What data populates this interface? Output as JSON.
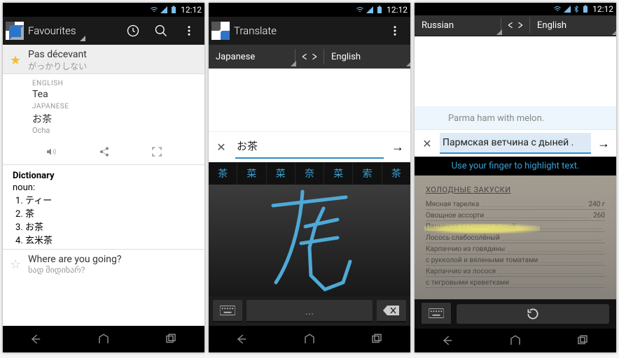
{
  "status": {
    "time": "12:12",
    "bt": true
  },
  "screen1": {
    "title": "Favourites",
    "rows": [
      {
        "main": "Pas décevant",
        "sub": "がっかりしない"
      }
    ],
    "detail": {
      "source_lang": "ENGLISH",
      "source_word": "Tea",
      "target_lang": "JAPANESE",
      "target_word": "お茶",
      "romanization": "Ocha"
    },
    "dictionary": {
      "title": "Dictionary",
      "pos": "noun:",
      "items": [
        "ティー",
        "茶",
        "お茶",
        "玄米茶"
      ]
    },
    "bottom": {
      "main": "Where are you going?",
      "sub": "სად მიდიხარ?"
    }
  },
  "screen2": {
    "title": "Translate",
    "from_lang": "Japanese",
    "to_lang": "English",
    "input": "お茶",
    "candidates": [
      "茶",
      "菜",
      "菜",
      "奈",
      "菜",
      "索",
      "茶"
    ],
    "space_label": "..."
  },
  "screen3": {
    "from_lang": "Russian",
    "to_lang": "English",
    "translation_out": "Parma ham with melon.",
    "input": "Пармская ветчина с дыней .",
    "hint": "Use your finger to highlight text.",
    "photo_title": "ХОЛОДНЫЕ ЗАКУСКИ",
    "menu": [
      {
        "name": "Мясная тарелка",
        "price": "240 г"
      },
      {
        "name": "Овощное ассорти",
        "price": "260"
      },
      {
        "name": "Пармская ветчина с дыней",
        "price": ""
      },
      {
        "name": "Лосось слабосолёный",
        "price": ""
      },
      {
        "name": "Карпаччио из говядины",
        "price": ""
      },
      {
        "name": "с рукколой и вялеными томатами",
        "price": ""
      },
      {
        "name": "Карпаччио из лосося",
        "price": ""
      },
      {
        "name": "с тигровыми креветками",
        "price": ""
      }
    ]
  }
}
